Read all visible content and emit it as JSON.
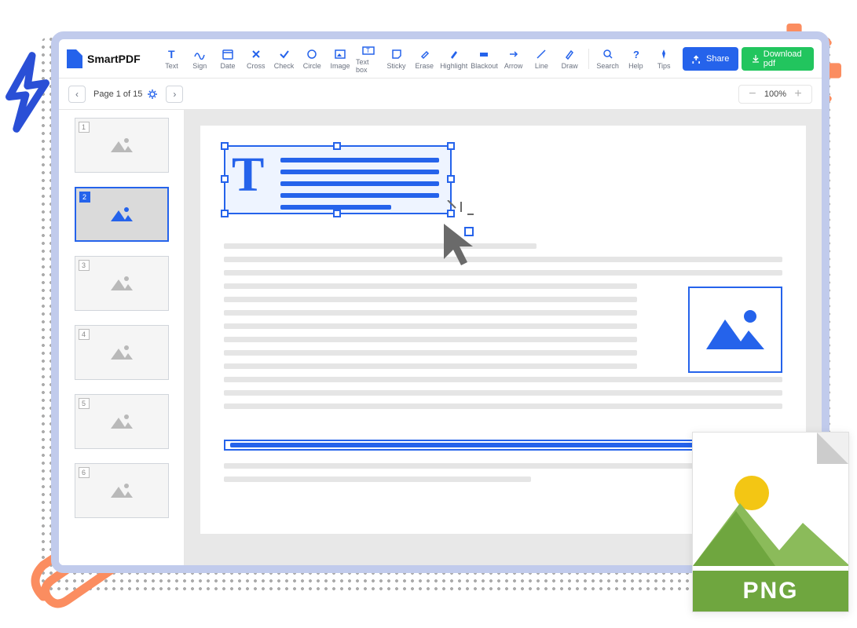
{
  "app": {
    "name": "SmartPDF"
  },
  "toolbar": {
    "tools": [
      {
        "id": "text",
        "label": "Text"
      },
      {
        "id": "sign",
        "label": "Sign"
      },
      {
        "id": "date",
        "label": "Date"
      },
      {
        "id": "cross",
        "label": "Cross"
      },
      {
        "id": "check",
        "label": "Check"
      },
      {
        "id": "circle",
        "label": "Circle"
      },
      {
        "id": "image",
        "label": "Image"
      },
      {
        "id": "textbox",
        "label": "Text box"
      },
      {
        "id": "sticky",
        "label": "Sticky"
      },
      {
        "id": "erase",
        "label": "Erase"
      },
      {
        "id": "highlight",
        "label": "Highlight"
      },
      {
        "id": "blackout",
        "label": "Blackout"
      },
      {
        "id": "arrow",
        "label": "Arrow"
      },
      {
        "id": "line",
        "label": "Line"
      },
      {
        "id": "draw",
        "label": "Draw"
      }
    ],
    "util": [
      {
        "id": "search",
        "label": "Search"
      },
      {
        "id": "help",
        "label": "Help"
      },
      {
        "id": "tips",
        "label": "Tips"
      }
    ],
    "share_label": "Share",
    "download_label": "Download pdf"
  },
  "page_nav": {
    "current": 1,
    "total": 15,
    "label": "Page 1 of 15"
  },
  "zoom": {
    "value": "100%"
  },
  "thumbnails": [
    {
      "num": "1",
      "active": false
    },
    {
      "num": "2",
      "active": true
    },
    {
      "num": "3",
      "active": false
    },
    {
      "num": "4",
      "active": false
    },
    {
      "num": "5",
      "active": false
    },
    {
      "num": "6",
      "active": false
    }
  ],
  "png_badge": {
    "label": "PNG"
  },
  "colors": {
    "primary": "#2563eb",
    "success": "#22c55e",
    "accent": "#fb8d60"
  }
}
